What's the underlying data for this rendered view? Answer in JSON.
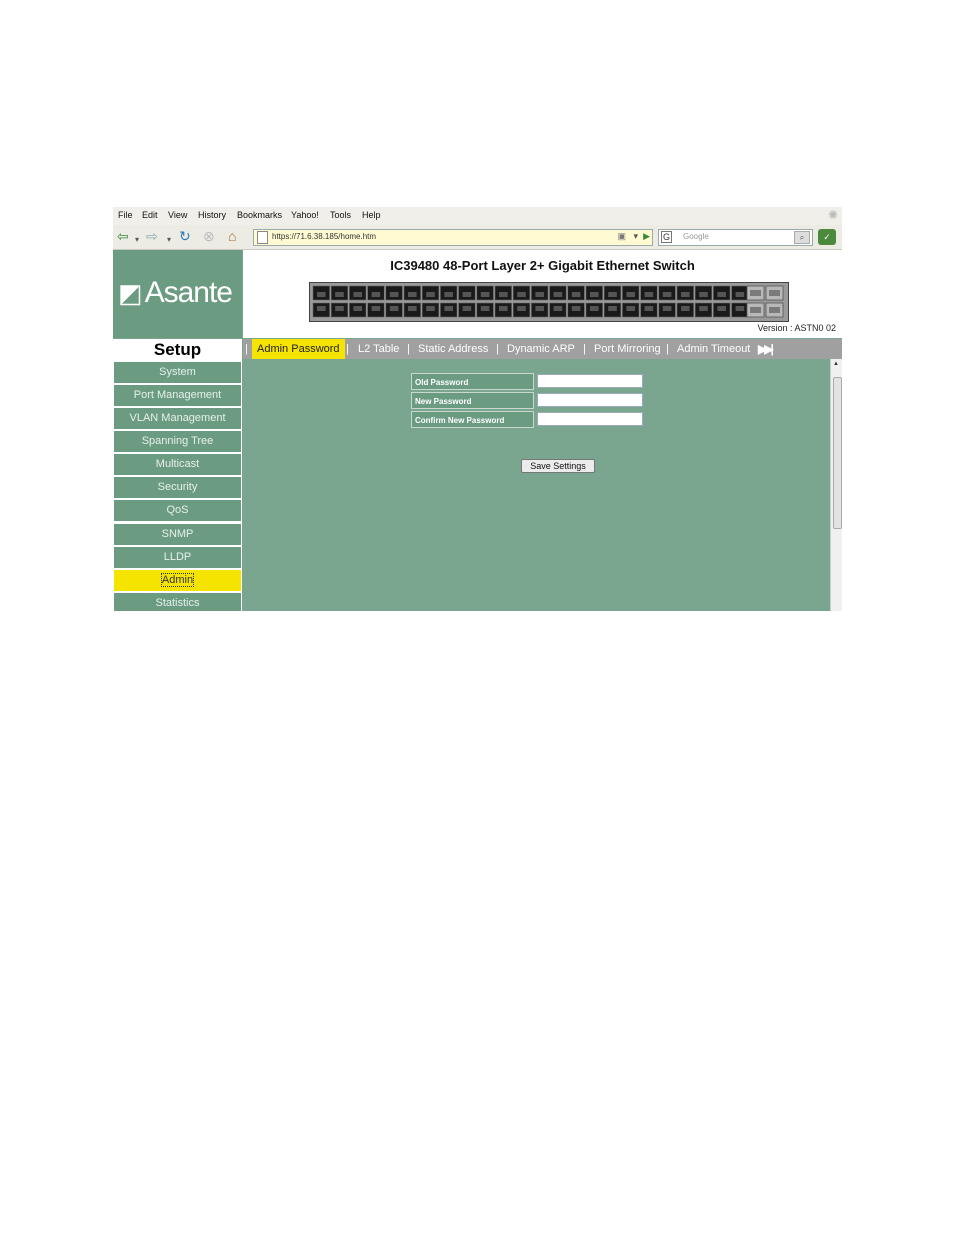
{
  "browser": {
    "menu": [
      "File",
      "Edit",
      "View",
      "History",
      "Bookmarks",
      "Yahoo!",
      "Tools",
      "Help"
    ],
    "url": "https://71.6.38.185/home.htm",
    "search_placeholder": "Google",
    "search_engine_label": "G",
    "icons": [
      "back-arrow-icon",
      "forward-arrow-icon",
      "reload-icon",
      "stop-icon",
      "home-icon",
      "page-icon",
      "go-icon",
      "search-icon"
    ]
  },
  "header": {
    "logo_text": "Asante",
    "title": "IC39480 48-Port Layer 2+ Gigabit Ethernet Switch",
    "version": "Version : ASTN0 02"
  },
  "sidebar": {
    "heading": "Setup",
    "items": [
      {
        "label": "System"
      },
      {
        "label": "Port Management"
      },
      {
        "label": "VLAN Management"
      },
      {
        "label": "Spanning Tree"
      },
      {
        "label": "Multicast"
      },
      {
        "label": "Security"
      },
      {
        "label": "QoS"
      },
      {
        "label": "SNMP"
      },
      {
        "label": "LLDP"
      },
      {
        "label": "Admin",
        "active": true
      },
      {
        "label": "Statistics"
      }
    ]
  },
  "tabs": [
    {
      "label": "Admin Password",
      "active": true
    },
    {
      "label": "L2 Table"
    },
    {
      "label": "Static Address"
    },
    {
      "label": "Dynamic ARP"
    },
    {
      "label": "Port Mirroring"
    },
    {
      "label": "Admin Timeout"
    }
  ],
  "tab_separator": "|",
  "form": {
    "fields": [
      {
        "label": "Old Password",
        "value": ""
      },
      {
        "label": "New Password",
        "value": ""
      },
      {
        "label": "Confirm New Password",
        "value": ""
      }
    ],
    "submit_label": "Save Settings"
  },
  "colors": {
    "panel_green": "#7aa68f",
    "sidebar_green": "#6b9c82",
    "active_yellow": "#f5e300",
    "tab_bar_gray": "#a0a0a0"
  }
}
